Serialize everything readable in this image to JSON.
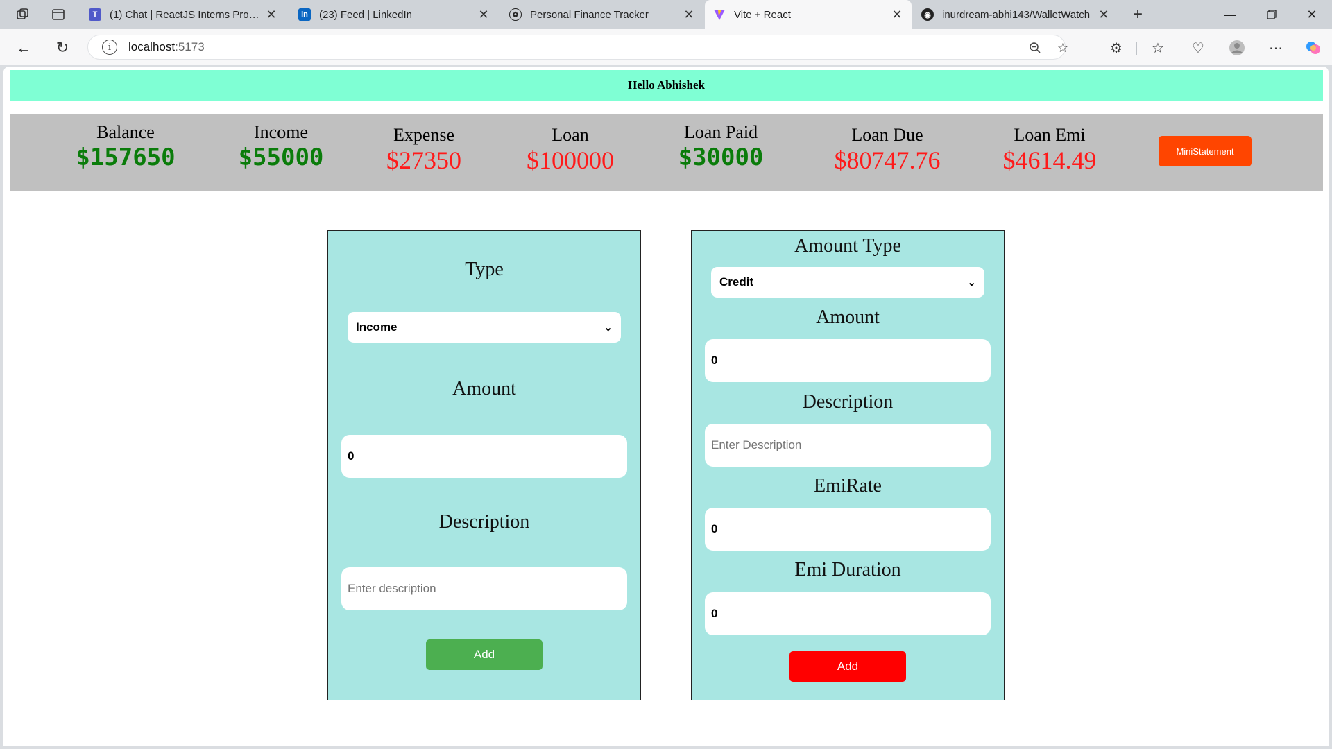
{
  "browser": {
    "tabs": [
      {
        "title": "(1) Chat | ReactJS Interns Progress",
        "favicon": "teams-icon"
      },
      {
        "title": "(23) Feed | LinkedIn",
        "favicon": "linkedin-icon"
      },
      {
        "title": "Personal Finance Tracker",
        "favicon": "openai-icon"
      },
      {
        "title": "Vite + React",
        "favicon": "vite-icon",
        "active": true
      },
      {
        "title": "inurdream-abhi143/WalletWatch",
        "favicon": "github-icon"
      }
    ],
    "url_host": "localhost",
    "url_port": ":5173"
  },
  "app": {
    "greeting": "Hello Abhishek",
    "stats": [
      {
        "label": "Balance",
        "value": "$157650",
        "color": "#0a7c0a"
      },
      {
        "label": "Income",
        "value": "$55000",
        "color": "#0a7c0a"
      },
      {
        "label": "Expense",
        "value": "$27350",
        "color": "#ff1a1a"
      },
      {
        "label": "Loan",
        "value": "$100000",
        "color": "#ff1a1a"
      },
      {
        "label": "Loan Paid",
        "value": "$30000",
        "color": "#0a7c0a"
      },
      {
        "label": "Loan Due",
        "value": "$80747.76",
        "color": "#ff1a1a"
      },
      {
        "label": "Loan Emi",
        "value": "$4614.49",
        "color": "#ff1a1a"
      }
    ],
    "mini_statement_label": "MiniStatement",
    "transaction_form": {
      "type_heading": "Type",
      "type_selected": "Income",
      "amount_heading": "Amount",
      "amount_value": "0",
      "description_heading": "Description",
      "description_placeholder": "Enter description",
      "add_label": "Add"
    },
    "loan_form": {
      "amount_type_heading": "Amount Type",
      "amount_type_selected": "Credit",
      "amount_heading": "Amount",
      "amount_value": "0",
      "description_heading": "Description",
      "description_placeholder": "Enter Description",
      "emi_rate_heading": "EmiRate",
      "emi_rate_value": "0",
      "emi_duration_heading": "Emi Duration",
      "emi_duration_value": "0",
      "add_label": "Add"
    }
  }
}
